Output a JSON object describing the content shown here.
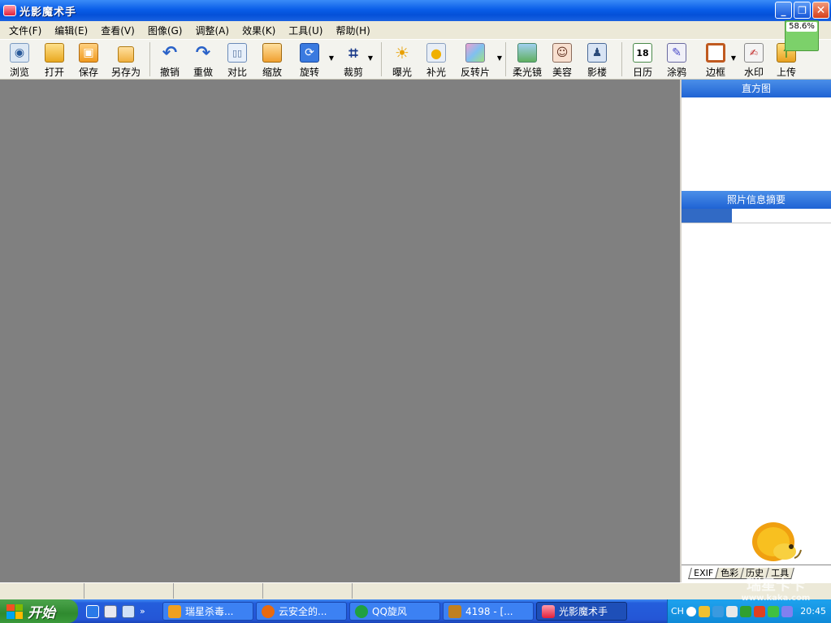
{
  "window": {
    "title": "光影魔术手",
    "buttons": {
      "minimize": "_",
      "restore": "❐",
      "close": "✕"
    }
  },
  "menu": [
    "文件(F)",
    "编辑(E)",
    "查看(V)",
    "图像(G)",
    "调整(A)",
    "效果(K)",
    "工具(U)",
    "帮助(H)"
  ],
  "zoom": "58.6%",
  "toolbar": {
    "browse": "浏览",
    "open": "打开",
    "save": "保存",
    "save_as": "另存为",
    "undo": "撤销",
    "redo": "重做",
    "compare": "对比",
    "resize": "缩放",
    "rotate": "旋转",
    "crop": "裁剪",
    "exposure": "曝光",
    "fill_light": "补光",
    "reversal": "反转片",
    "soft_focus": "柔光镜",
    "beauty": "美容",
    "studio": "影楼",
    "calendar": "日历",
    "doodle": "涂鸦",
    "frame": "边框",
    "watermark": "水印",
    "upload": "上传"
  },
  "panel": {
    "histogram_title": "直方图",
    "info_title": "照片信息摘要",
    "tabs": [
      "EXIF",
      "色彩",
      "历史",
      "工具"
    ]
  },
  "taskbar": {
    "start": "开始",
    "tasks": [
      "瑞星杀毒...",
      "云安全的...",
      "QQ旋风",
      "4198 - [...",
      "光影魔术手"
    ],
    "ime": "CH",
    "clock": "20:45"
  },
  "watermark": {
    "brand": "瑞星卡卡",
    "url": "www.kaka.com"
  }
}
